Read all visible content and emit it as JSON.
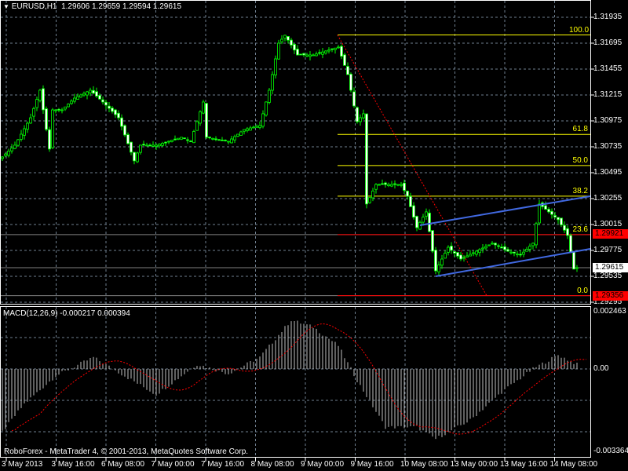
{
  "header": {
    "symbol": "EURUSD,H1",
    "open": "1.29606",
    "high": "1.29659",
    "low": "1.29594",
    "close": "1.29615",
    "menu_icon": "triangle-down-icon"
  },
  "price_axis": [
    "1.31935",
    "1.31695",
    "1.31455",
    "1.31215",
    "1.30975",
    "1.30735",
    "1.30495",
    "1.30255",
    "1.30015",
    "1.29775",
    "1.29535",
    "1.29295"
  ],
  "price_markers": {
    "level_23_6": "1.29921",
    "current": "1.29615",
    "level_0": "1.29356"
  },
  "fibonacci": {
    "levels": [
      "100.0",
      "61.8",
      "50.0",
      "38.2",
      "23.6",
      "0.0"
    ],
    "prices": [
      1.31771,
      1.3085,
      1.30561,
      1.30278,
      1.29921,
      1.29356
    ]
  },
  "macd": {
    "label": "MACD(12,26,9) -0.000217 0.000394",
    "axis_top": "0.002463",
    "axis_zero": "0.00",
    "axis_bottom": "-0.003364"
  },
  "footer": {
    "copyright": "RoboForex - MetaTrader 4, © 2001-2013, MetaQuotes Software Corp."
  },
  "time_axis": [
    "3 May 2013",
    "3 May 16:00",
    "6 May 08:00",
    "7 May 00:00",
    "7 May 16:00",
    "8 May 08:00",
    "9 May 00:00",
    "9 May 16:00",
    "10 May 08:00",
    "13 May 00:00",
    "13 May 16:00",
    "14 May 08:00"
  ],
  "colors": {
    "candle": "#00ff00",
    "fib": "#ffff00",
    "trend": "#ff0000",
    "channel": "#4169e1",
    "histogram": "#c0c0c0",
    "signal": "#ff0000"
  },
  "chart_data": {
    "type": "candlestick",
    "price_keypoints": [
      [
        0,
        1.30641
      ],
      [
        4,
        1.3075
      ],
      [
        9,
        1.31004
      ],
      [
        12,
        1.31259
      ],
      [
        15,
        1.30714
      ],
      [
        16,
        1.31077
      ],
      [
        19,
        1.31077
      ],
      [
        23,
        1.31186
      ],
      [
        28,
        1.31259
      ],
      [
        32,
        1.3115
      ],
      [
        37,
        1.31004
      ],
      [
        42,
        1.30605
      ],
      [
        44,
        1.3075
      ],
      [
        49,
        1.3075
      ],
      [
        57,
        1.30823
      ],
      [
        60,
        1.30786
      ],
      [
        64,
        1.3115
      ],
      [
        65,
        1.30823
      ],
      [
        72,
        1.30786
      ],
      [
        77,
        1.30895
      ],
      [
        82,
        1.30932
      ],
      [
        85,
        1.31259
      ],
      [
        88,
        1.31695
      ],
      [
        90,
        1.31768
      ],
      [
        94,
        1.31586
      ],
      [
        99,
        1.31586
      ],
      [
        107,
        1.31659
      ],
      [
        110,
        1.31404
      ],
      [
        113,
        1.30968
      ],
      [
        115,
        1.31041
      ],
      [
        116,
        1.30205
      ],
      [
        119,
        1.30386
      ],
      [
        127,
        1.30386
      ],
      [
        129,
        1.30277
      ],
      [
        132,
        1.29986
      ],
      [
        135,
        1.30132
      ],
      [
        138,
        1.29586
      ],
      [
        142,
        1.29804
      ],
      [
        146,
        1.29695
      ],
      [
        151,
        1.29768
      ],
      [
        156,
        1.29841
      ],
      [
        161,
        1.29768
      ],
      [
        165,
        1.29732
      ],
      [
        169,
        1.29841
      ],
      [
        171,
        1.30205
      ],
      [
        177,
        1.3006
      ],
      [
        180,
        1.29914
      ],
      [
        182,
        1.29602
      ],
      [
        183,
        1.29615
      ]
    ],
    "macd_keypoints": [
      [
        0,
        -0.0027
      ],
      [
        7,
        -0.0015
      ],
      [
        17,
        -0.0003
      ],
      [
        29,
        0.0005
      ],
      [
        39,
        -0.0003
      ],
      [
        49,
        -0.0011
      ],
      [
        62,
        0.0002
      ],
      [
        72,
        -0.0002
      ],
      [
        82,
        0.0005
      ],
      [
        92,
        0.0021
      ],
      [
        99,
        0.0018
      ],
      [
        107,
        0.001
      ],
      [
        113,
        -0.0005
      ],
      [
        122,
        -0.0025
      ],
      [
        132,
        -0.0025
      ],
      [
        138,
        -0.003
      ],
      [
        149,
        -0.0022
      ],
      [
        159,
        -0.001
      ],
      [
        169,
        0.0
      ],
      [
        177,
        0.0006
      ],
      [
        183,
        0.0002
      ]
    ],
    "price_range": [
      1.29235,
      1.32025
    ],
    "macd_range": [
      -0.003364,
      0.002463
    ]
  }
}
